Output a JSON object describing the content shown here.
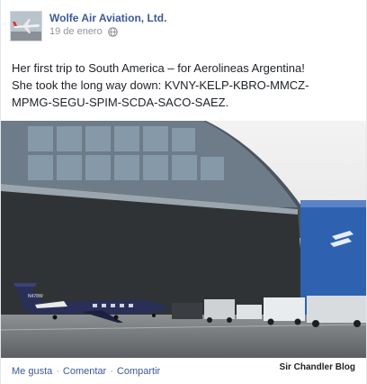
{
  "post": {
    "author": "Wolfe Air Aviation, Ltd.",
    "date": "19 de enero",
    "message_line1": "Her first trip to South America – for Aerolineas Argentina!",
    "message_line2": "She took the long way down: KVNY-KELP-KBRO-MMCZ-",
    "message_line3": "MPMG-SEGU-SPIM-SCDA-SACO-SAEZ.",
    "privacy_icon": "globe-icon",
    "photo_subject": "business jet parked in front of a large hangar",
    "aircraft_registration": "N478W"
  },
  "actions": {
    "like": "Me gusta",
    "comment": "Comentar",
    "share": "Compartir",
    "separator": "·"
  },
  "watermark": "Sir Chandler Blog",
  "colors": {
    "link": "#3b5998",
    "text": "#1d2129",
    "muted": "#90949c"
  }
}
